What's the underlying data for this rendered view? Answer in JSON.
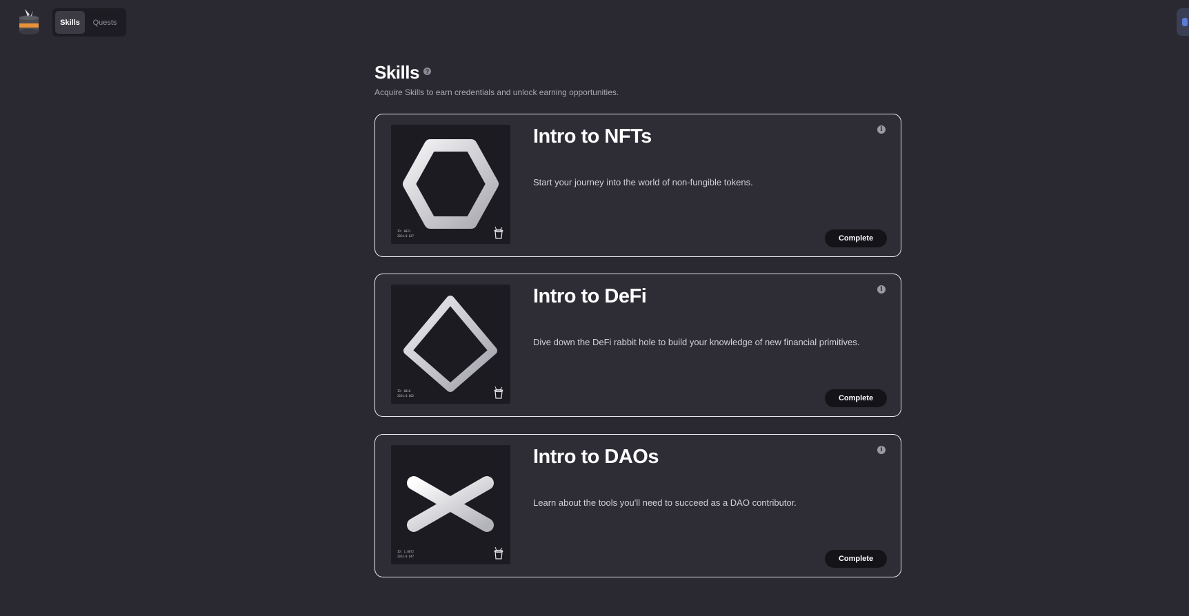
{
  "nav": {
    "tabs": [
      {
        "label": "Skills",
        "active": true
      },
      {
        "label": "Quests",
        "active": false
      }
    ]
  },
  "header": {
    "title": "Skills",
    "subtitle": "Acquire Skills to earn credentials and unlock earning opportunities."
  },
  "cards": [
    {
      "title": "Intro to NFTs",
      "description": "Start your journey into the world of non-fungible tokens.",
      "button_label": "Complete",
      "art_icon": "hexagon-ring",
      "art_caption": [
        "ID: 0023",
        "2024.0.027"
      ]
    },
    {
      "title": "Intro to DeFi",
      "description": "Dive down the DeFi rabbit hole to build your knowledge of new financial primitives.",
      "button_label": "Complete",
      "art_icon": "diamond-prism",
      "art_caption": [
        "ID: 0010",
        "2024.0.002"
      ]
    },
    {
      "title": "Intro to DAOs",
      "description": "Learn about the tools you'll need to succeed as a DAO contributor.",
      "button_label": "Complete",
      "art_icon": "asterisk",
      "art_caption": [
        "ID: 1.0072",
        "2024.0.047"
      ]
    }
  ],
  "colors": {
    "background": "#2a2931",
    "card_background": "#2e2d36",
    "card_border": "#e8e8ec",
    "button_background": "#141318"
  }
}
